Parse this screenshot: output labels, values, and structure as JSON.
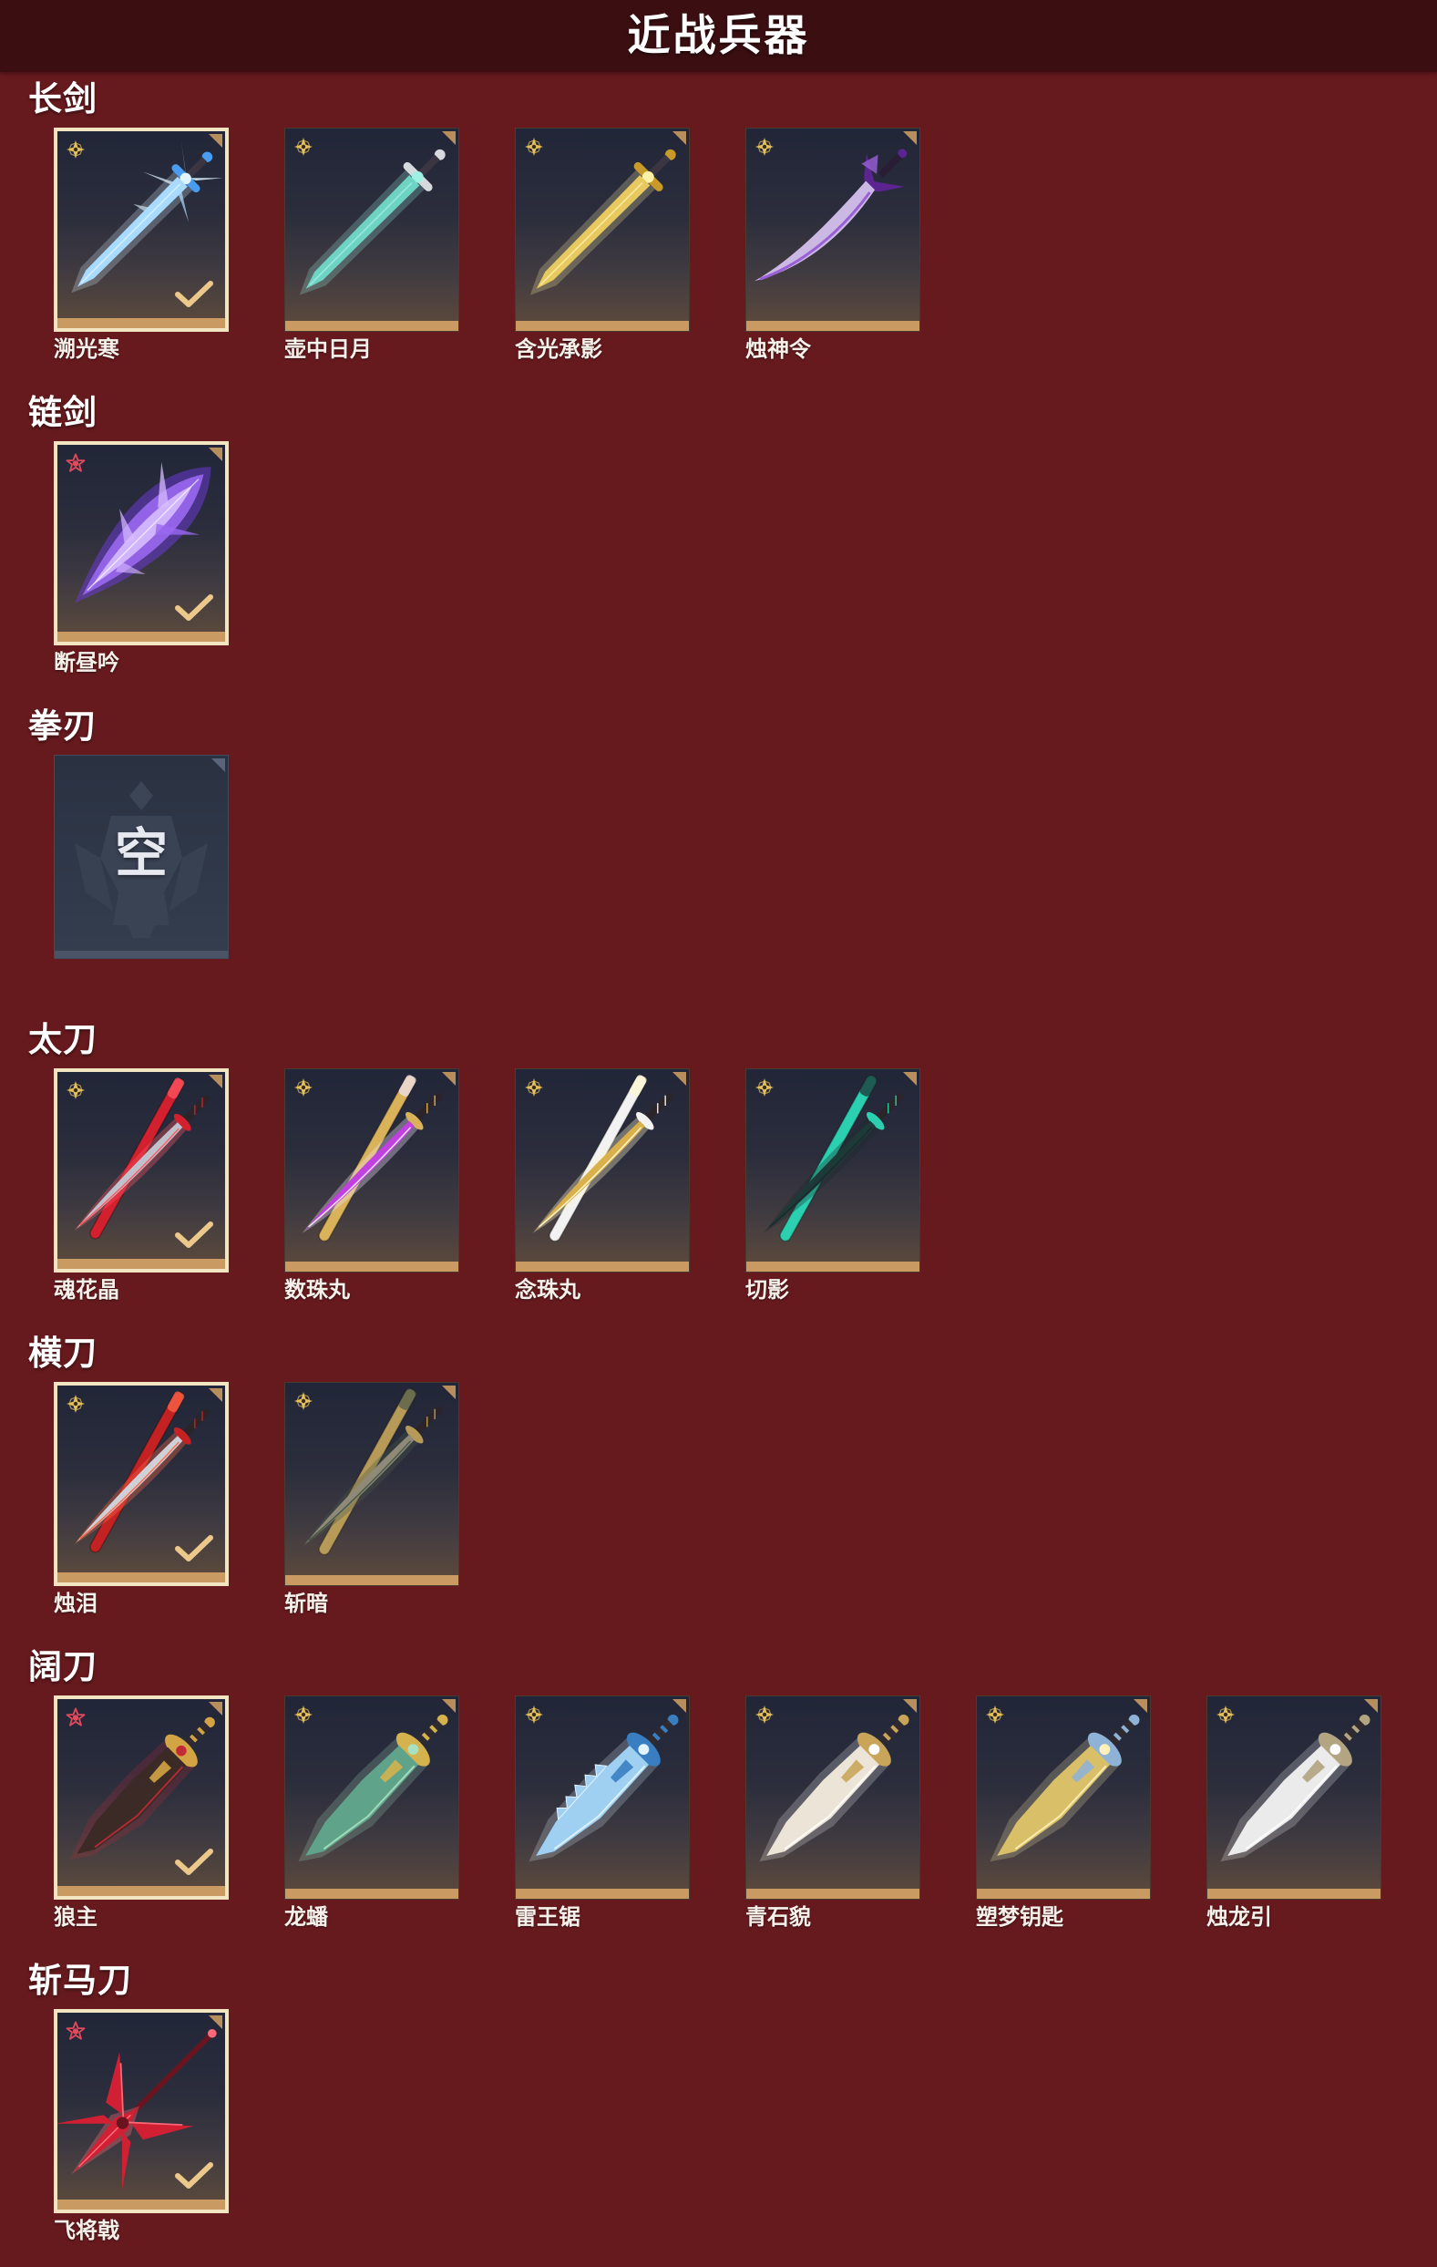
{
  "header": {
    "title": "近战兵器"
  },
  "theme": {
    "page_bg": "#671a1e",
    "header_bg": "#3b0f12",
    "card_bar": "#c99b62",
    "selected_border": "#f3e4c2",
    "check_color": "#ecc98a",
    "gold_star": "#e5c15a",
    "red_star": "#e24a5c"
  },
  "sections": [
    {
      "title": "长剑",
      "items": [
        {
          "name": "溯光寒",
          "rarity_icon": "gold-star-icon",
          "selected": true,
          "art_icon": "crystal-sword-icon",
          "colors": {
            "blade": "#a8dbff",
            "trim": "#4a9cf0",
            "glow": "#dff4ff"
          }
        },
        {
          "name": "壶中日月",
          "rarity_icon": "gold-star-icon",
          "selected": false,
          "art_icon": "longsword-icon",
          "colors": {
            "blade": "#6fd3c4",
            "trim": "#d6dadc",
            "glow": "#9ff0e4"
          }
        },
        {
          "name": "含光承影",
          "rarity_icon": "gold-star-icon",
          "selected": false,
          "art_icon": "longsword-icon",
          "colors": {
            "blade": "#e7c95f",
            "trim": "#c79a2a",
            "glow": "#fff0a8"
          }
        },
        {
          "name": "烛神令",
          "rarity_icon": "gold-star-icon",
          "selected": false,
          "art_icon": "curved-sword-icon",
          "colors": {
            "blade": "#cbb9e3",
            "trim": "#5b2490",
            "glow": "#9a60d8"
          }
        }
      ]
    },
    {
      "title": "链剑",
      "items": [
        {
          "name": "断昼吟",
          "rarity_icon": "red-star-icon",
          "selected": true,
          "art_icon": "flame-whip-icon",
          "colors": {
            "blade": "#9a68f0",
            "trim": "#d7bcff",
            "glow": "#6a3ad0"
          }
        }
      ]
    },
    {
      "title": "拳刃",
      "items": [],
      "empty_slot": {
        "text": "空",
        "icon": "empty-slot-emblem-icon"
      }
    },
    {
      "title": "太刀",
      "items": [
        {
          "name": "魂花晶",
          "rarity_icon": "gold-star-icon",
          "selected": true,
          "art_icon": "katana-icon",
          "colors": {
            "blade": "#bfc2cc",
            "trim": "#d2202f",
            "glow": "#ff5a64"
          }
        },
        {
          "name": "数珠丸",
          "rarity_icon": "gold-star-icon",
          "selected": false,
          "art_icon": "katana-icon",
          "colors": {
            "blade": "#c040e0",
            "trim": "#d9b25a",
            "glow": "#f1e6f8"
          }
        },
        {
          "name": "念珠丸",
          "rarity_icon": "gold-star-icon",
          "selected": false,
          "art_icon": "katana-icon",
          "colors": {
            "blade": "#d9b04a",
            "trim": "#f2f2f2",
            "glow": "#fff6d0"
          }
        },
        {
          "name": "切影",
          "rarity_icon": "gold-star-icon",
          "selected": false,
          "art_icon": "katana-icon",
          "colors": {
            "blade": "#1d3a38",
            "trim": "#2ad0b0",
            "glow": "#1b2a2c"
          }
        }
      ]
    },
    {
      "title": "横刀",
      "items": [
        {
          "name": "烛泪",
          "rarity_icon": "gold-star-icon",
          "selected": true,
          "art_icon": "katana-icon",
          "colors": {
            "blade": "#cfd1d8",
            "trim": "#c42222",
            "glow": "#ff6a4a"
          }
        },
        {
          "name": "斩暗",
          "rarity_icon": "gold-star-icon",
          "selected": false,
          "art_icon": "katana-icon",
          "colors": {
            "blade": "#8f8a78",
            "trim": "#b89a58",
            "glow": "#4a5a48"
          }
        }
      ]
    },
    {
      "title": "阔刀",
      "items": [
        {
          "name": "狼主",
          "rarity_icon": "red-star-icon",
          "selected": true,
          "art_icon": "broadsword-icon",
          "colors": {
            "blade": "#3b2a26",
            "trim": "#d3a444",
            "glow": "#c22a36"
          }
        },
        {
          "name": "龙蟠",
          "rarity_icon": "gold-star-icon",
          "selected": false,
          "art_icon": "broadsword-icon",
          "colors": {
            "blade": "#5fa48a",
            "trim": "#d4b24e",
            "glow": "#a8e0c0"
          }
        },
        {
          "name": "雷王锯",
          "rarity_icon": "gold-star-icon",
          "selected": false,
          "art_icon": "saw-broadsword-icon",
          "colors": {
            "blade": "#9fd0f2",
            "trim": "#3a7ec2",
            "glow": "#e2f4ff"
          }
        },
        {
          "name": "青石貌",
          "rarity_icon": "gold-star-icon",
          "selected": false,
          "art_icon": "broadsword-icon",
          "colors": {
            "blade": "#ece4d6",
            "trim": "#c9a55a",
            "glow": "#ffffff"
          }
        },
        {
          "name": "塑梦钥匙",
          "rarity_icon": "gold-star-icon",
          "selected": false,
          "art_icon": "broadsword-icon",
          "colors": {
            "blade": "#d9bf68",
            "trim": "#8fb3d6",
            "glow": "#fff1b8"
          }
        },
        {
          "name": "烛龙引",
          "rarity_icon": "gold-star-icon",
          "selected": false,
          "art_icon": "broadsword-icon",
          "colors": {
            "blade": "#ebebeb",
            "trim": "#b3a482",
            "glow": "#ffffff"
          }
        }
      ]
    },
    {
      "title": "斩马刀",
      "items": [
        {
          "name": "飞将戟",
          "rarity_icon": "red-star-icon",
          "selected": true,
          "art_icon": "halberd-icon",
          "colors": {
            "blade": "#d11f34",
            "trim": "#6a1420",
            "glow": "#ff6a78"
          }
        }
      ]
    }
  ]
}
